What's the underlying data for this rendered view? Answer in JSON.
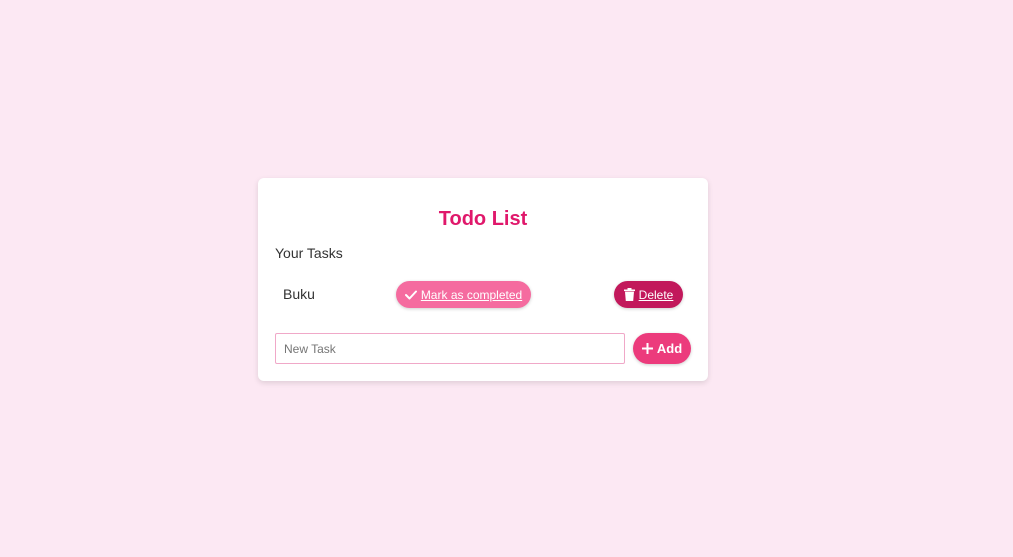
{
  "app": {
    "title": "Todo List"
  },
  "tasks_section": {
    "heading": "Your Tasks",
    "items": [
      {
        "text": "Buku",
        "complete_label": "Mark as completed",
        "complete_icon": "check-icon",
        "delete_label": "Delete",
        "delete_icon": "trash-icon"
      }
    ]
  },
  "new_task": {
    "placeholder": "New Task",
    "value": "",
    "add_label": "Add",
    "add_icon": "plus-icon"
  },
  "colors": {
    "background": "#fce8f3",
    "title": "#e0186b",
    "complete_button": "#f56b9f",
    "delete_button": "#c2185b",
    "add_button": "#ec3b7c"
  }
}
